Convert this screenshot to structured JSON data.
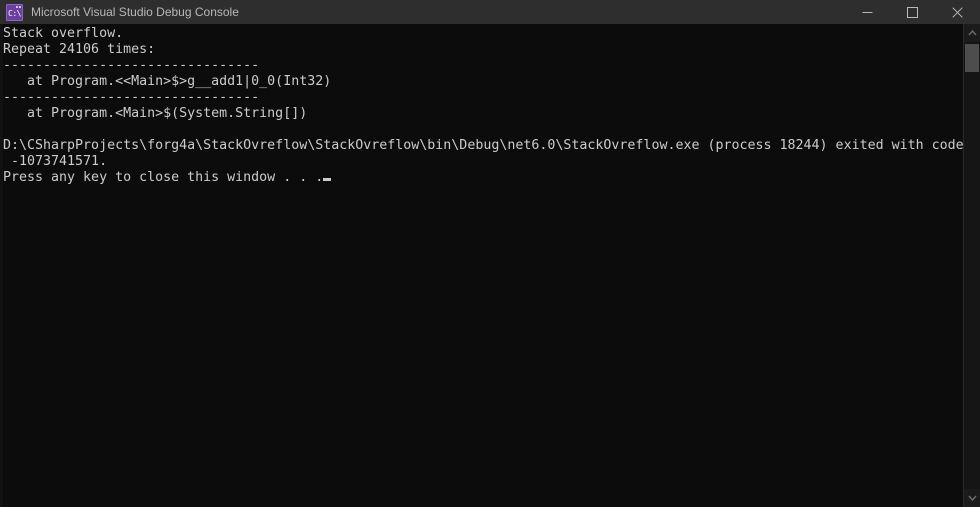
{
  "window": {
    "title": "Microsoft Visual Studio Debug Console",
    "icon_name": "console-app-icon",
    "icon_glyph": "C:\\",
    "background_color": "#0c0c0c",
    "titlebar_color": "#2e2e2e",
    "text_color": "#cccccc",
    "icon_accent_color": "#6b3fa0"
  },
  "titlebar": {
    "minimize_label": "Minimize",
    "maximize_label": "Maximize",
    "close_label": "Close"
  },
  "console": {
    "lines": [
      "Stack overflow.",
      "Repeat 24106 times:",
      "--------------------------------",
      "   at Program.<<Main>$>g__add1|0_0(Int32)",
      "--------------------------------",
      "   at Program.<Main>$(System.String[])",
      "",
      "D:\\CSharpProjects\\forg4a\\StackOvreflow\\StackOvreflow\\bin\\Debug\\net6.0\\StackOvreflow.exe (process 18244) exited with code",
      " -1073741571.",
      "Press any key to close this window . . ."
    ],
    "prompt_text": "Press any key to close this window . . .",
    "exception_text": "Stack overflow.",
    "repeat_text": "Repeat 24106 times:",
    "repeat_count": "24106",
    "frame_1": "   at Program.<<Main>$>g__add1|0_0(Int32)",
    "frame_2": "   at Program.<Main>$(System.String[])",
    "separator": "--------------------------------",
    "exe_path": "D:\\CSharpProjects\\forg4a\\StackOvreflow\\StackOvreflow\\bin\\Debug\\net6.0\\StackOvreflow.exe",
    "process_id": "18244",
    "exit_code": "-1073741571"
  },
  "scrollbar": {
    "up_arrow_name": "scroll-up-arrow",
    "down_arrow_name": "scroll-down-arrow",
    "thumb_name": "scrollbar-thumb"
  }
}
